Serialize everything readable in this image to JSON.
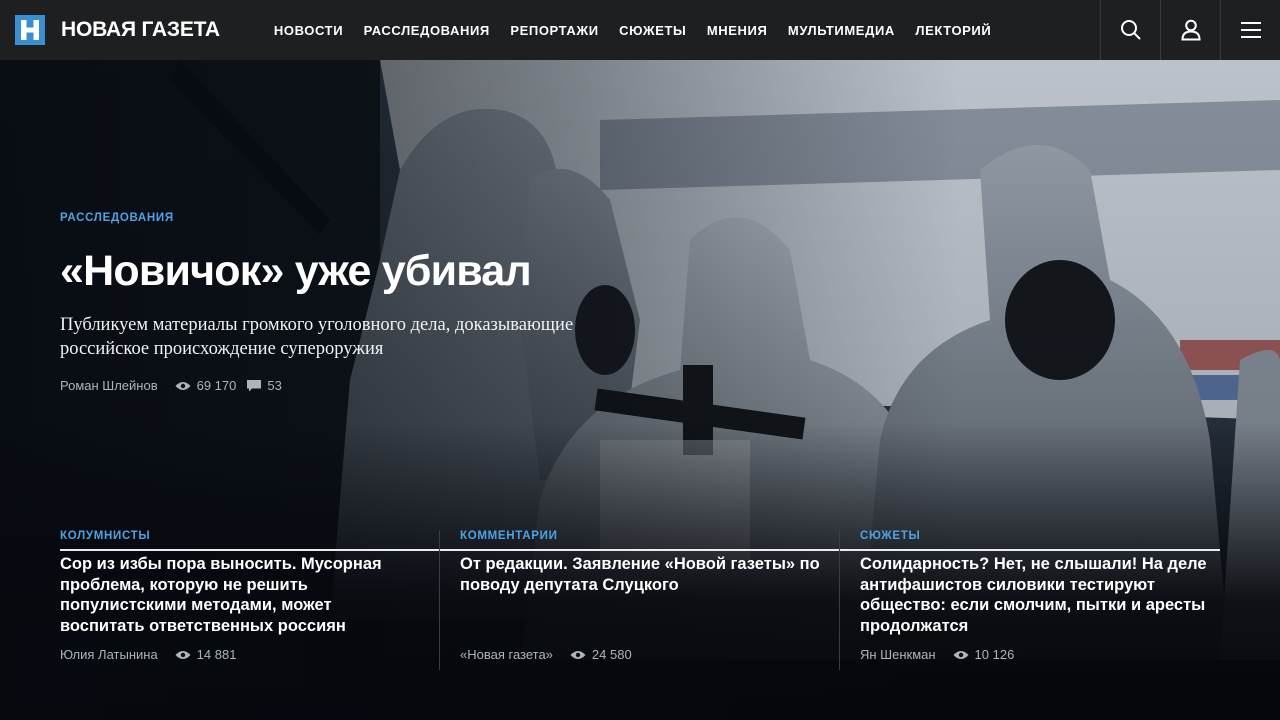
{
  "brand": {
    "name": "НОВАЯ ГАЗЕТА",
    "logo_color": "#3a8fd0"
  },
  "nav": {
    "items": [
      {
        "label": "НОВОСТИ"
      },
      {
        "label": "РАССЛЕДОВАНИЯ"
      },
      {
        "label": "РЕПОРТАЖИ"
      },
      {
        "label": "СЮЖЕТЫ"
      },
      {
        "label": "МНЕНИЯ"
      },
      {
        "label": "МУЛЬТИМЕДИА"
      },
      {
        "label": "ЛЕКТОРИЙ"
      }
    ],
    "actions": [
      "search-icon",
      "user-icon",
      "menu-icon"
    ]
  },
  "hero": {
    "category": "РАССЛЕДОВАНИЯ",
    "title": "«Новичок» уже убивал",
    "lead": "Публикуем материалы громкого уголовного дела, доказывающие российское происхождение супероружия",
    "author": "Роман Шлейнов",
    "views": "69 170",
    "comments": "53"
  },
  "cards": [
    {
      "category": "КОЛУМНИСТЫ",
      "title": "Сор из избы пора выносить. Мусорная проблема, которую не решить популистскими методами, может воспитать ответственных россиян",
      "author": "Юлия Латынина",
      "views": "14 881"
    },
    {
      "category": "КОММЕНТАРИИ",
      "title": "От редакции. Заявление «Новой газеты» по поводу депутата Слуцкого",
      "author": "«Новая газета»",
      "views": "24 580"
    },
    {
      "category": "СЮЖЕТЫ",
      "title": "Солидарность? Нет, не слышали! На деле антифашистов силовики тестируют общество: если смолчим, пытки и аресты продолжатся",
      "author": "Ян Шенкман",
      "views": "10 126"
    }
  ],
  "colors": {
    "accent": "#4ea3e3",
    "topbar": "#1e1f21",
    "meta": "#aeb4ba"
  }
}
